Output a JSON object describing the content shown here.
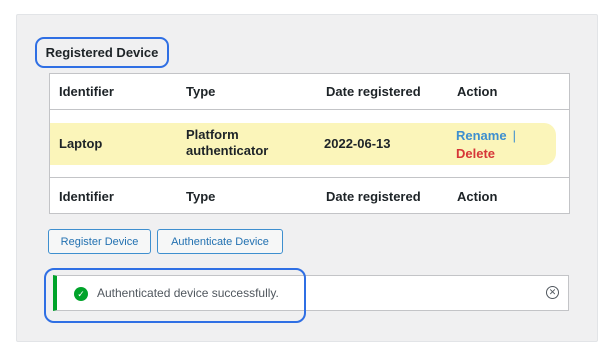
{
  "section": {
    "title": "Registered Device"
  },
  "table": {
    "headers": [
      "Identifier",
      "Type",
      "Date registered",
      "Action"
    ],
    "rows": [
      {
        "identifier": "Laptop",
        "type": "Platform authenticator",
        "date": "2022-06-13",
        "actions": {
          "rename": "Rename",
          "separator": "|",
          "delete": "Delete"
        }
      }
    ],
    "footer_headers": [
      "Identifier",
      "Type",
      "Date registered",
      "Action"
    ]
  },
  "buttons": {
    "register": "Register Device",
    "authenticate": "Authenticate Device"
  },
  "notice": {
    "message": "Authenticated device successfully.",
    "status_icon": "check-circle-icon",
    "dismiss_icon": "close-circle-icon",
    "status_color": "#00a32a"
  },
  "colors": {
    "highlight_row": "#fbf5ba",
    "link": "#3e8fcf",
    "danger": "#d63638",
    "annotation": "#2f6fe4"
  }
}
